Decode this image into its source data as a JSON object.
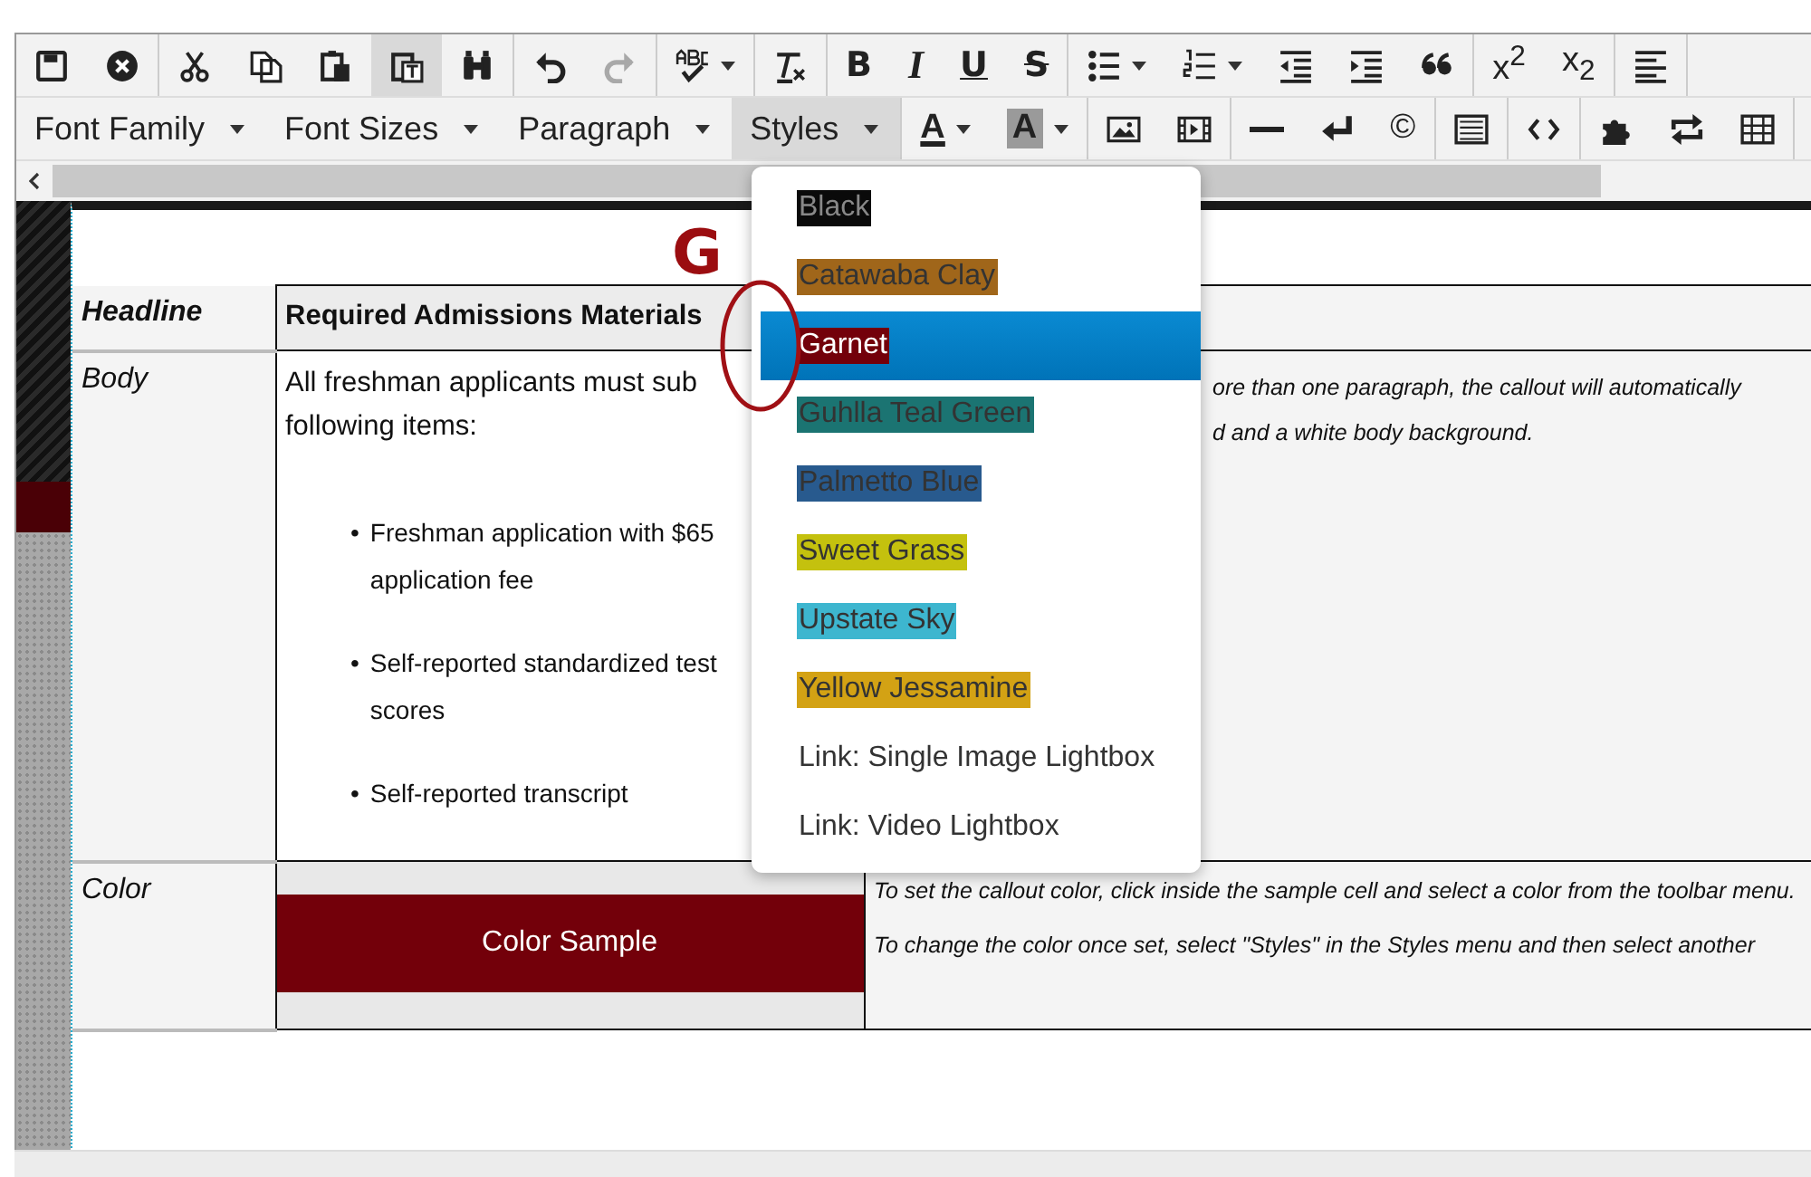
{
  "toolbar": {
    "rows": [
      {
        "groups": [
          {
            "buttons": [
              {
                "kind": "save",
                "active": false,
                "disabled": false
              },
              {
                "kind": "cancel",
                "active": false,
                "disabled": false
              }
            ]
          },
          {
            "buttons": [
              {
                "kind": "cut",
                "active": false,
                "disabled": false
              },
              {
                "kind": "copy",
                "active": false,
                "disabled": false
              },
              {
                "kind": "paste",
                "active": false,
                "disabled": false
              },
              {
                "kind": "paste-text",
                "active": true,
                "disabled": false
              },
              {
                "kind": "find",
                "active": false,
                "disabled": false
              }
            ]
          },
          {
            "buttons": [
              {
                "kind": "undo",
                "active": false,
                "disabled": false
              },
              {
                "kind": "redo",
                "active": false,
                "disabled": true
              }
            ]
          },
          {
            "buttons": [
              {
                "kind": "spellcheck",
                "active": false,
                "disabled": false,
                "menu": true
              }
            ]
          },
          {
            "buttons": [
              {
                "kind": "clear-format",
                "active": false,
                "disabled": false
              }
            ]
          },
          {
            "buttons": [
              {
                "kind": "bold",
                "label": "B",
                "active": false,
                "disabled": false
              },
              {
                "kind": "italic",
                "label": "I",
                "active": false,
                "disabled": false
              },
              {
                "kind": "underline",
                "label": "U",
                "active": false,
                "disabled": false
              },
              {
                "kind": "strike",
                "label": "S",
                "active": false,
                "disabled": false
              }
            ]
          },
          {
            "buttons": [
              {
                "kind": "bullets",
                "active": false,
                "disabled": false,
                "menu": true
              },
              {
                "kind": "numbers",
                "active": false,
                "disabled": false,
                "menu": true
              },
              {
                "kind": "outdent",
                "active": false,
                "disabled": false
              },
              {
                "kind": "indent",
                "active": false,
                "disabled": false
              },
              {
                "kind": "quote",
                "active": false,
                "disabled": false
              }
            ]
          },
          {
            "buttons": [
              {
                "kind": "superscript",
                "label": "x$^{2}$",
                "active": false,
                "disabled": false
              },
              {
                "kind": "subscript",
                "label": "x$_{2}$",
                "active": false,
                "disabled": false
              }
            ]
          },
          {
            "buttons": [
              {
                "kind": "align-left",
                "active": false,
                "disabled": false
              }
            ]
          }
        ]
      },
      {
        "groups": [
          {
            "buttons": [
              {
                "kind": "dropdown",
                "label": "Font Family",
                "active": false,
                "disabled": false,
                "menu": true
              },
              {
                "kind": "dropdown",
                "label": "Font Sizes",
                "active": false,
                "disabled": false,
                "menu": true
              },
              {
                "kind": "dropdown",
                "label": "Paragraph",
                "active": false,
                "disabled": false,
                "menu": true
              },
              {
                "kind": "dropdown",
                "label": "Styles",
                "active": true,
                "disabled": false,
                "menu": true
              }
            ]
          },
          {
            "buttons": [
              {
                "kind": "text-color",
                "label": "A",
                "active": false,
                "disabled": false,
                "menu": true
              },
              {
                "kind": "bg-color",
                "label": "A",
                "active": false,
                "disabled": false,
                "menu": true
              }
            ]
          },
          {
            "buttons": [
              {
                "kind": "image",
                "active": false,
                "disabled": false
              },
              {
                "kind": "media",
                "active": false,
                "disabled": false
              }
            ]
          },
          {
            "buttons": [
              {
                "kind": "hr",
                "active": false,
                "disabled": false
              },
              {
                "kind": "return",
                "active": false,
                "disabled": false
              },
              {
                "kind": "copyright",
                "label": "©",
                "active": false,
                "disabled": false
              }
            ]
          },
          {
            "buttons": [
              {
                "kind": "template",
                "active": false,
                "disabled": false
              }
            ]
          },
          {
            "buttons": [
              {
                "kind": "code",
                "active": false,
                "disabled": false
              }
            ]
          },
          {
            "buttons": [
              {
                "kind": "puzzle",
                "active": false,
                "disabled": false
              },
              {
                "kind": "swap",
                "active": false,
                "disabled": false
              },
              {
                "kind": "table",
                "active": false,
                "disabled": false
              }
            ]
          }
        ]
      }
    ]
  },
  "document": {
    "logo": "G",
    "rows": [
      {
        "label": "Headline",
        "content": {
          "kind": "heading",
          "text": "Required Admissions Materials"
        },
        "notes": []
      },
      {
        "label": "Body",
        "content": {
          "kind": "list",
          "bullet": "•",
          "lines": [
            "All freshman applicants must sub",
            "following items:"
          ],
          "items": [
            "Freshman application with $65 application fee",
            "Self-reported standardized test scores",
            "Self-reported transcript"
          ]
        },
        "notes": [
          "ore than one paragraph, the callout will automatically",
          "d and a white body background."
        ]
      },
      {
        "label": "Color",
        "content": {
          "kind": "sample",
          "text": "Color Sample"
        },
        "notes": [
          "To set the callout color, click inside the sample cell and select a color from the toolbar menu.",
          "To change the color once set, select \"Styles\" in the Styles menu and then select another"
        ]
      }
    ]
  },
  "styles_menu": {
    "items": [
      {
        "kind": "swatch",
        "label": "Black",
        "color": "#0a0a0a",
        "selected": false
      },
      {
        "kind": "swatch",
        "label": "Catawaba Clay",
        "color": "#a0661a",
        "selected": false
      },
      {
        "kind": "swatch",
        "label": "Garnet",
        "color": "#73000a",
        "selected": true
      },
      {
        "kind": "swatch",
        "label": "Guhlla Teal Green",
        "color": "#1b7472",
        "selected": false
      },
      {
        "kind": "swatch",
        "label": "Palmetto Blue",
        "color": "#285a8e",
        "selected": false
      },
      {
        "kind": "swatch",
        "label": "Sweet Grass",
        "color": "#c4c10e",
        "selected": false
      },
      {
        "kind": "swatch",
        "label": "Upstate Sky",
        "color": "#3db6cf",
        "selected": false
      },
      {
        "kind": "swatch",
        "label": "Yellow Jessamine",
        "color": "#d3a214",
        "selected": false
      },
      {
        "kind": "plain",
        "label": "Link: Single Image Lightbox",
        "selected": false
      },
      {
        "kind": "plain",
        "label": "Link: Video Lightbox",
        "selected": false
      }
    ]
  }
}
